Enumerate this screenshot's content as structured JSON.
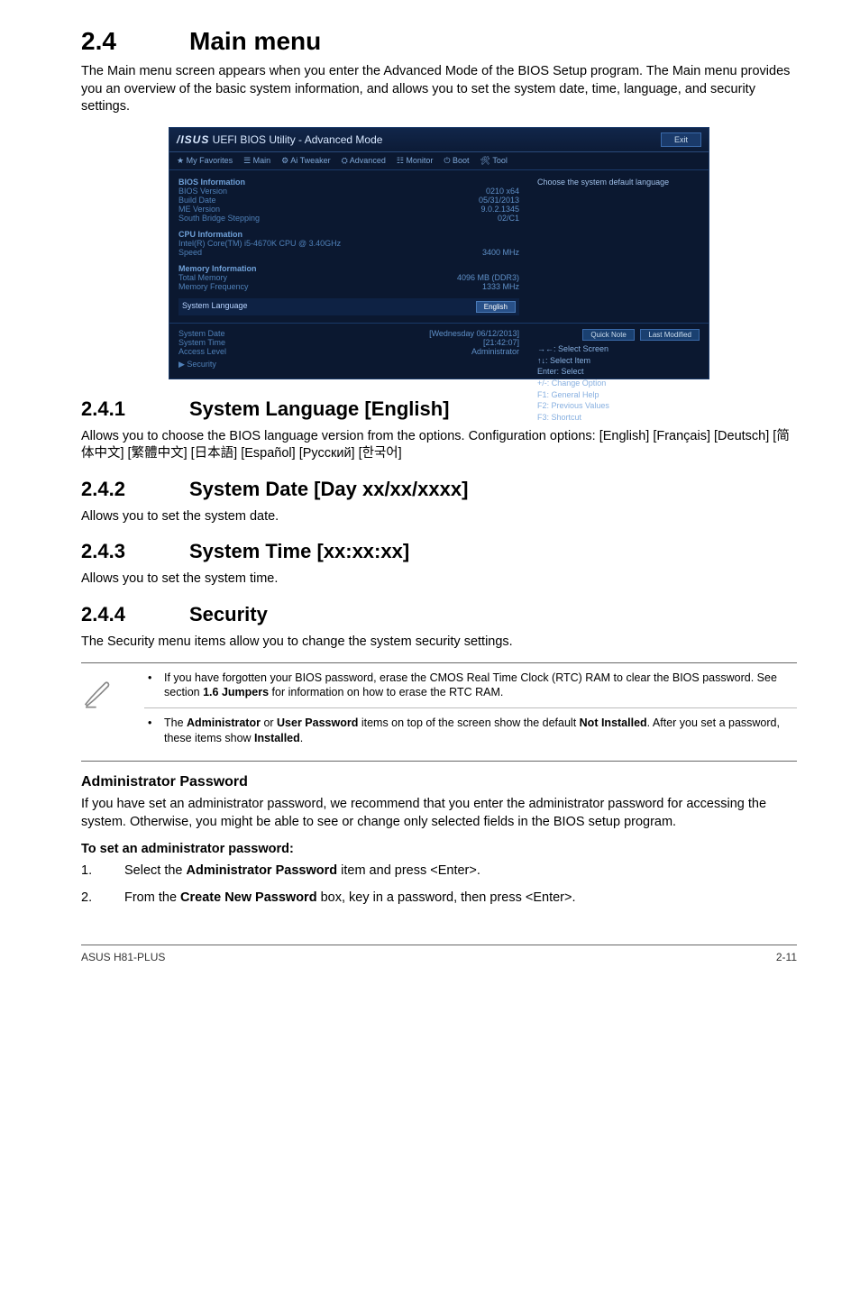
{
  "section": {
    "num": "2.4",
    "title": "Main menu"
  },
  "intro": "The Main menu screen appears when you enter the Advanced Mode of the BIOS Setup program. The Main menu provides you an overview of the basic system information, and allows you to set the system date, time, language, and security settings.",
  "bios": {
    "brand": "/ISUS",
    "title": " UEFI BIOS Utility - Advanced Mode",
    "exit": "Exit",
    "tabs": [
      "★ My Favorites",
      "☰ Main",
      "⚙ Ai Tweaker",
      "⛭ Advanced",
      "☷ Monitor",
      "⏻ Boot",
      "🛠 Tool"
    ],
    "right_hint": "Choose the system default language",
    "groups": [
      {
        "hdr": "BIOS Information",
        "rows": [
          {
            "k": "BIOS Version",
            "v": "0210 x64"
          },
          {
            "k": "Build Date",
            "v": "05/31/2013"
          },
          {
            "k": "ME Version",
            "v": "9.0.2.1345"
          },
          {
            "k": "South Bridge Stepping",
            "v": "02/C1"
          }
        ]
      },
      {
        "hdr": "CPU Information",
        "rows": [
          {
            "k": "Intel(R) Core(TM) i5-4670K CPU @ 3.40GHz",
            "v": ""
          },
          {
            "k": "Speed",
            "v": "3400 MHz"
          }
        ]
      },
      {
        "hdr": "Memory Information",
        "rows": [
          {
            "k": "Total Memory",
            "v": "4096 MB (DDR3)"
          },
          {
            "k": "Memory Frequency",
            "v": "1333 MHz"
          }
        ]
      }
    ],
    "lang_label": "System Language",
    "lang_value": "English",
    "date_label": "System Date",
    "date_value": "[Wednesday 06/12/2013]",
    "time_label": "System Time",
    "time_value": "[21:42:07]",
    "access_label": "Access Level",
    "access_value": "Administrator",
    "security_label": "▶ Security",
    "note_btn1": "Quick Note",
    "note_btn2": "Last Modified",
    "help": [
      "→←: Select Screen",
      "↑↓: Select Item",
      "Enter: Select",
      "+/-: Change Option",
      "F1: General Help",
      "F2: Previous Values",
      "F3: Shortcut"
    ]
  },
  "s241": {
    "num": "2.4.1",
    "title": "System Language [English]",
    "body": "Allows you to choose the BIOS language version from the options. Configuration options: [English] [Français] [Deutsch] [简体中文] [繁體中文] [日本語] [Español] [Русский] [한국어]"
  },
  "s242": {
    "num": "2.4.2",
    "title": "System Date [Day xx/xx/xxxx]",
    "body": "Allows you to set the system date."
  },
  "s243": {
    "num": "2.4.3",
    "title": "System Time [xx:xx:xx]",
    "body": "Allows you to set the system time."
  },
  "s244": {
    "num": "2.4.4",
    "title": "Security",
    "body": "The Security menu items allow you to change the system security settings."
  },
  "notes": {
    "n1a": "If you have forgotten your BIOS password, erase the CMOS Real Time Clock (RTC) RAM to clear the BIOS password. See section ",
    "n1b": "1.6 Jumpers",
    "n1c": " for information on how to erase the RTC RAM.",
    "n2a": "The ",
    "n2b": "Administrator",
    "n2c": " or ",
    "n2d": "User Password",
    "n2e": " items on top of the screen show the default ",
    "n2f": "Not Installed",
    "n2g": ". After you set a password, these items show ",
    "n2h": "Installed",
    "n2i": "."
  },
  "admin": {
    "title": "Administrator Password",
    "body": "If you have set an administrator password, we recommend that you enter the administrator password for accessing the system. Otherwise, you might be able to see or change only selected fields in the BIOS setup program.",
    "toset": "To set an administrator password:",
    "step1a": "Select the ",
    "step1b": "Administrator Password",
    "step1c": " item and press <Enter>.",
    "step2a": "From the ",
    "step2b": "Create New Password",
    "step2c": " box, key in a password, then press <Enter>."
  },
  "footer": {
    "left": "ASUS H81-PLUS",
    "right": "2-11"
  }
}
